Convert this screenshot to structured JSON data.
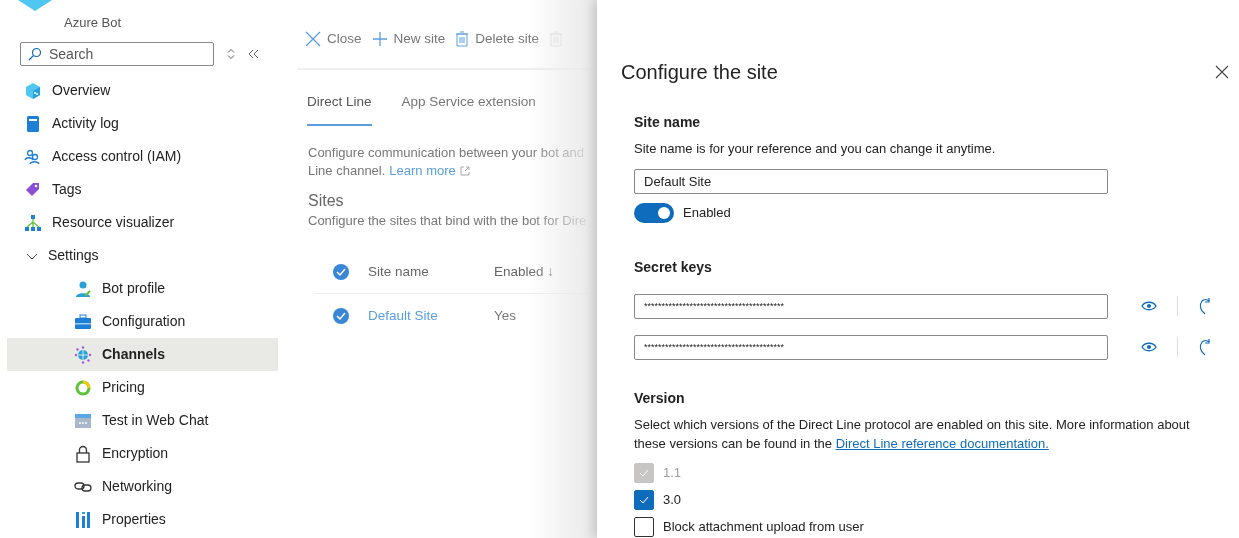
{
  "header": {
    "title": "Azure Bot"
  },
  "sidebar": {
    "search": {
      "placeholder": "Search"
    },
    "items": [
      {
        "label": "Overview",
        "selected": false
      },
      {
        "label": "Activity log",
        "selected": false
      },
      {
        "label": "Access control (IAM)",
        "selected": false
      },
      {
        "label": "Tags",
        "selected": false
      },
      {
        "label": "Resource visualizer",
        "selected": false
      },
      {
        "label": "Settings",
        "selected": false,
        "expanded": true,
        "children": [
          {
            "label": "Bot profile",
            "selected": false
          },
          {
            "label": "Configuration",
            "selected": false
          },
          {
            "label": "Channels",
            "selected": true
          },
          {
            "label": "Pricing",
            "selected": false
          },
          {
            "label": "Test in Web Chat",
            "selected": false
          },
          {
            "label": "Encryption",
            "selected": false
          },
          {
            "label": "Networking",
            "selected": false
          },
          {
            "label": "Properties",
            "selected": false
          }
        ]
      }
    ]
  },
  "blade": {
    "toolbar": [
      "Close",
      "New site",
      "Delete site"
    ],
    "tabs": [
      {
        "label": "Direct Line",
        "selected": true
      },
      {
        "label": "App Service extension",
        "selected": false
      }
    ],
    "intro": "Configure communication between your bot and",
    "intro_2": "Line channel.",
    "learn_more": "Learn more",
    "sites_heading": "Sites",
    "sites_description": "Configure the sites that bind with the bot for Dire",
    "columns": [
      "Site name",
      "Enabled ↓"
    ],
    "rows": [
      {
        "site_name": "Default Site",
        "enabled": "Yes"
      }
    ]
  },
  "panel": {
    "title": "Configure the site",
    "site_name_heading": "Site name",
    "site_name_description": "Site name is for your reference and you can change it anytime.",
    "site_name_value": "Default Site",
    "enabled_toggle": {
      "label": "Enabled",
      "on": true
    },
    "secret_keys_heading": "Secret keys",
    "secret_keys": [
      "****************************************",
      "****************************************"
    ],
    "version_heading": "Version",
    "version_description": "Select which versions of the Direct Line protocol are enabled on this site. More information about these versions can be found in the",
    "version_link": "Direct Line reference documentation.",
    "options": [
      {
        "label": "1.1",
        "checked": true,
        "disabled": true
      },
      {
        "label": "3.0",
        "checked": true,
        "disabled": false
      },
      {
        "label": "Block attachment upload from user",
        "checked": false,
        "disabled": false
      }
    ]
  }
}
